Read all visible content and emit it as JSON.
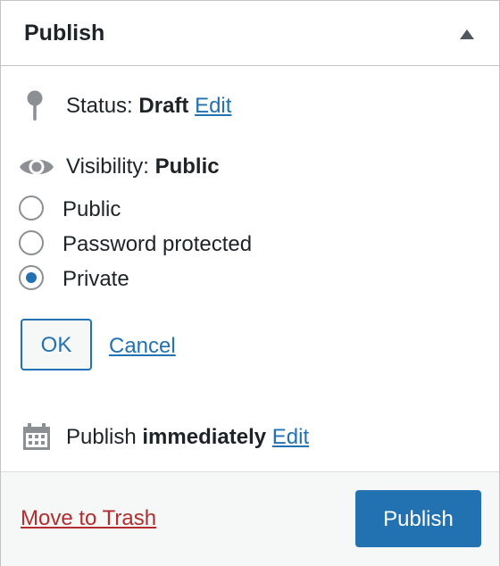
{
  "panel": {
    "title": "Publish",
    "toggle_icon": "triangle-up-icon"
  },
  "status": {
    "icon": "pin-icon",
    "label": "Status:",
    "value": "Draft",
    "edit_link": "Edit"
  },
  "visibility": {
    "icon": "eye-icon",
    "label": "Visibility:",
    "value": "Public",
    "options": [
      {
        "label": "Public",
        "checked": false
      },
      {
        "label": "Password protected",
        "checked": false
      },
      {
        "label": "Private",
        "checked": true
      }
    ],
    "ok_label": "OK",
    "cancel_label": "Cancel"
  },
  "schedule": {
    "icon": "calendar-icon",
    "label": "Publish",
    "value": "immediately",
    "edit_link": "Edit"
  },
  "footer": {
    "trash_label": "Move to Trash",
    "publish_label": "Publish"
  },
  "colors": {
    "accent": "#2271b1",
    "danger": "#b32d2e",
    "icon_gray": "#8c8f94",
    "border": "#c3c4c7",
    "footer_bg": "#f6f7f7"
  }
}
